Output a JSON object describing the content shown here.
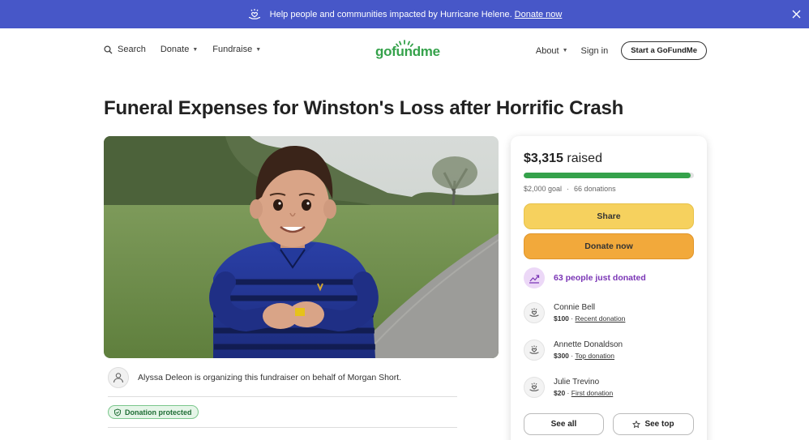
{
  "banner": {
    "text": "Help people and communities impacted by Hurricane Helene.",
    "link": "Donate now",
    "icon": "hands-heart-icon",
    "background": "#4757c8"
  },
  "nav": {
    "search": "Search",
    "donate": "Donate",
    "fundraise": "Fundraise",
    "about": "About",
    "sign_in": "Sign in",
    "start": "Start a GoFundMe"
  },
  "logo": {
    "text": "gofundme",
    "color": "#35a24b"
  },
  "campaign": {
    "title": "Funeral Expenses for Winston's Loss after Horrific Crash",
    "organizer_text": "Alyssa Deleon is organizing this fundraiser on behalf of Morgan Short.",
    "protected": "Donation protected"
  },
  "card": {
    "raised_amount": "$3,315",
    "raised_label": "raised",
    "progress": 0.98,
    "goal": "$2,000 goal",
    "donations": "66 donations",
    "share": "Share",
    "donate_now": "Donate now",
    "just_donated": "63 people just donated",
    "donors": [
      {
        "name": "Connie Bell",
        "amount": "$100",
        "tag": "Recent donation"
      },
      {
        "name": "Annette Donaldson",
        "amount": "$300",
        "tag": "Top donation"
      },
      {
        "name": "Julie Trevino",
        "amount": "$20",
        "tag": "First donation"
      }
    ],
    "see_all": "See all",
    "see_top": "See top"
  }
}
